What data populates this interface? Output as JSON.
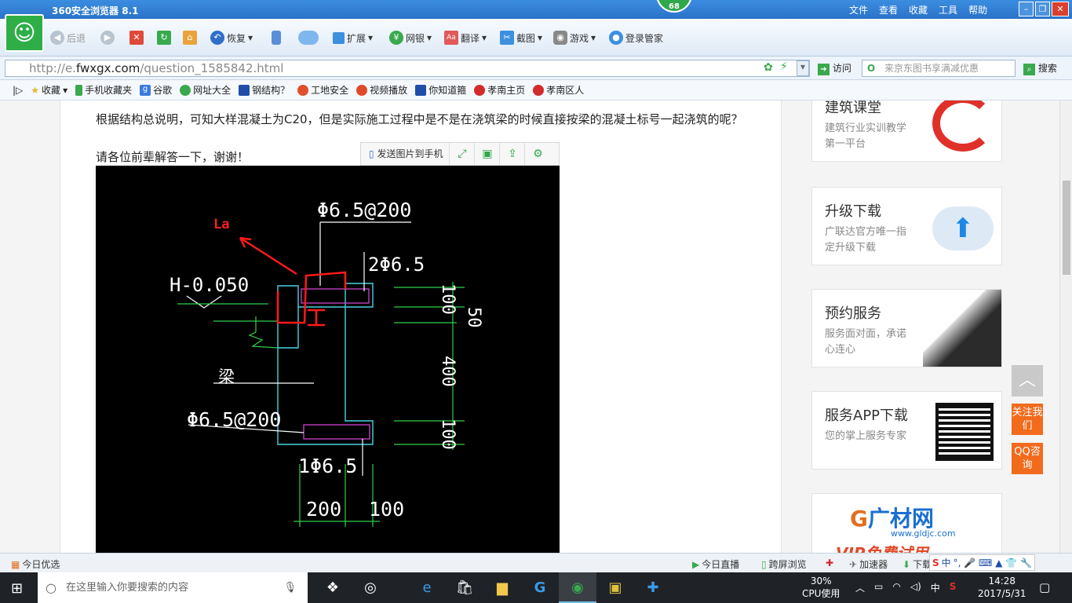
{
  "browser": {
    "title": "360安全浏览器 8.1",
    "badge": "68",
    "menus": [
      "文件",
      "查看",
      "收藏",
      "工具",
      "帮助"
    ]
  },
  "toolbar": {
    "back": "后退",
    "restore": "恢复",
    "extend": "扩展",
    "bank": "网银",
    "translate": "翻译",
    "screenshot": "截图",
    "games": "游戏",
    "login": "登录管家"
  },
  "address": {
    "prefix": "http://e.",
    "domain": "fwxgx.com",
    "path": "/question_1585842.html",
    "visit": "访问",
    "search_placeholder": "来京东图书享满减优惠",
    "search_btn": "搜索"
  },
  "favorites": [
    "收藏",
    "手机收藏夹",
    "谷歌",
    "网址大全",
    "钢结构？",
    "工地安全",
    "视频播放",
    "你知道箍",
    "孝南主页",
    "孝南区人"
  ],
  "question": {
    "line1": "根据结构总说明，可知大样混凝土为C20，但是实际施工过程中是不是在浇筑梁的时候直接按梁的混凝土标号一起浇筑的呢？",
    "line2": "请各位前辈解答一下，谢谢！"
  },
  "image_toolbar": {
    "send": "发送图片到手机"
  },
  "cad": {
    "top_rebar": "Φ6.5@200",
    "la": "La",
    "elevation": "H-0.050",
    "top_bars": "2Φ6.5",
    "beam": "梁",
    "dim_100a": "100",
    "dim_50": "50",
    "dim_400": "400",
    "dim_100b": "100",
    "left_rebar": "Φ6.5@200",
    "bottom_bar": "1Φ6.5",
    "dim_200": "200",
    "dim_100c": "100"
  },
  "sidebar": {
    "card0": {
      "title": "建筑课堂",
      "sub": "建筑行业实训教学第一平台"
    },
    "card1": {
      "title": "升级下载",
      "sub": "广联达官方唯一指定升级下载"
    },
    "card2": {
      "title": "预约服务",
      "sub": "服务面对面，承诺心连心"
    },
    "card3": {
      "title": "服务APP下载",
      "sub": "您的掌上服务专家"
    },
    "card4": {
      "logo": "广材网",
      "site": "www.gldjc.com",
      "promo": "VIP免费试用"
    }
  },
  "float": {
    "follow": "关注我们",
    "qq": "QQ咨询"
  },
  "status": {
    "today": "今日优选",
    "live": "今日直播",
    "cross": "跨屏浏览",
    "accel": "加速器",
    "download": "下载",
    "ime": "中"
  },
  "taskbar": {
    "search": "在这里输入你要搜索的内容",
    "cpu_pct": "30%",
    "cpu_label": "CPU使用",
    "lang": "中",
    "time": "14:28",
    "date": "2017/5/31"
  }
}
